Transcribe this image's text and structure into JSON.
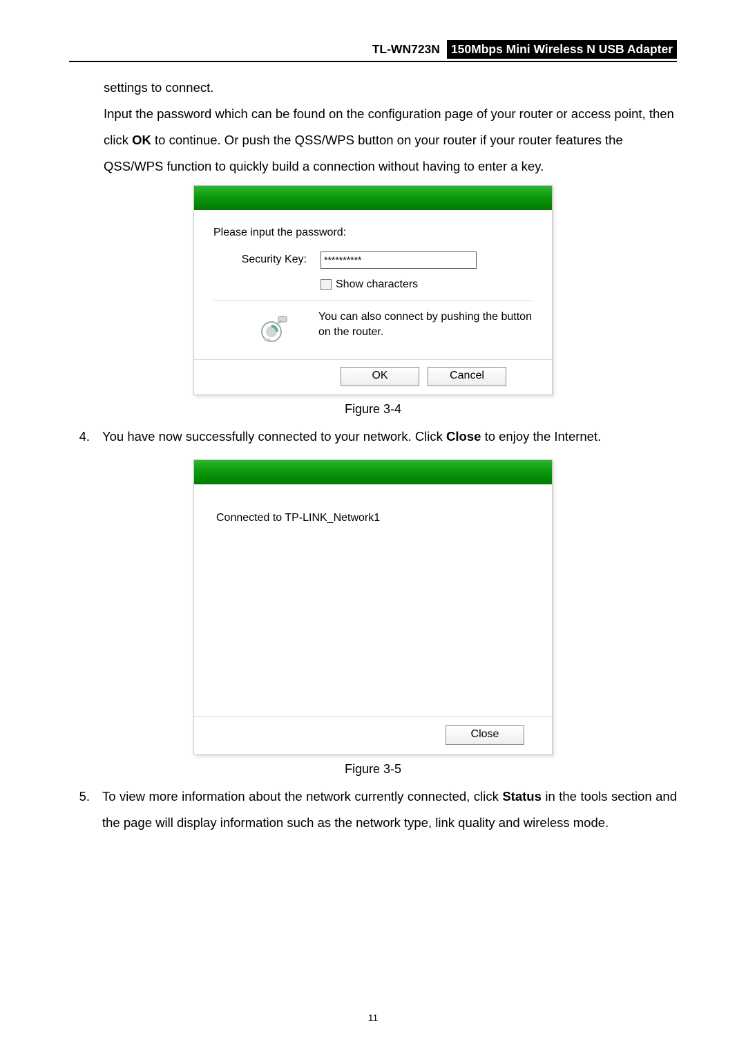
{
  "header": {
    "model": "TL-WN723N",
    "subtitle": "150Mbps Mini Wireless N USB Adapter"
  },
  "para1_a": "settings to connect.",
  "para1_b_pre": "Input the password which can be found on the configuration page of your router or access point, then click ",
  "para1_b_bold": "OK",
  "para1_b_post": " to continue. Or push the QSS/WPS button on your router if your router features the QSS/WPS function to quickly build a connection without having to enter a key.",
  "dialog1": {
    "prompt": "Please input the password:",
    "key_label": "Security Key:",
    "key_value": "**********",
    "show_chars": "Show characters",
    "wps_hint": "You can also connect by pushing the button on the router.",
    "ok": "OK",
    "cancel": "Cancel"
  },
  "fig34": "Figure 3-4",
  "item4": {
    "num": "4.",
    "pre": "You have now successfully connected to your network. Click ",
    "bold": "Close",
    "post": " to enjoy the Internet."
  },
  "dialog2": {
    "connected": "Connected to TP-LINK_Network1",
    "close": "Close"
  },
  "fig35": "Figure 3-5",
  "item5": {
    "num": "5.",
    "pre": "To view more information about the network currently connected, click ",
    "bold": "Status",
    "post": " in the tools section and the page will display information such as the network type, link quality and wireless mode."
  },
  "page_number": "11"
}
